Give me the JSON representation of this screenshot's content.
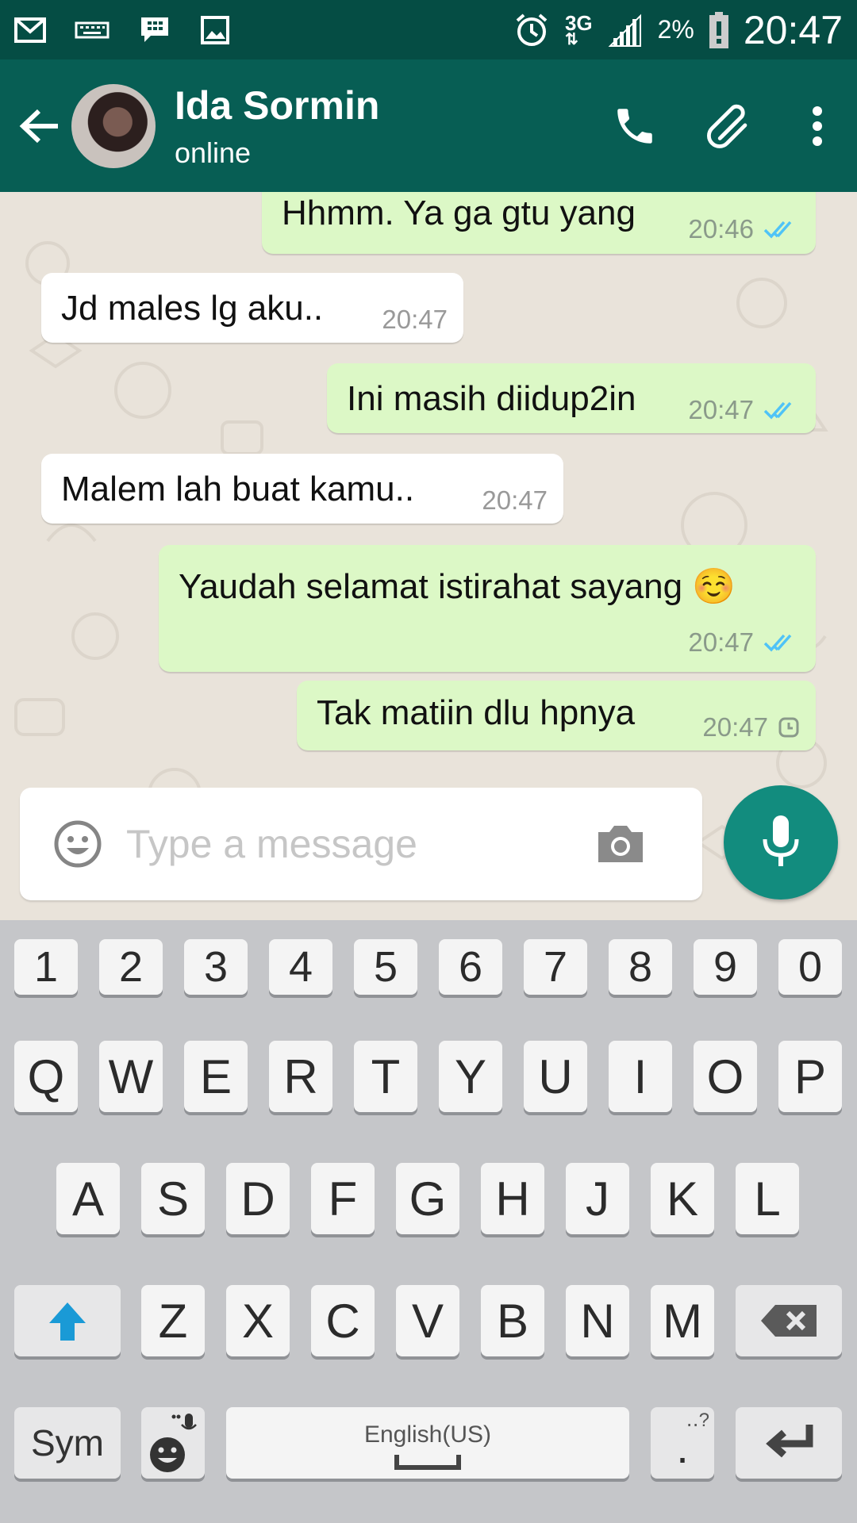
{
  "status_bar": {
    "time": "20:47",
    "battery": "2%",
    "network": "3G",
    "icons": [
      "gmail-icon",
      "keyboard-icon",
      "bbm-icon",
      "gallery-icon",
      "alarm-icon",
      "signal-icon",
      "battery-low-icon"
    ]
  },
  "header": {
    "contact_name": "Ida Sormin",
    "contact_status": "online",
    "icons": [
      "back-arrow-icon",
      "phone-icon",
      "paperclip-icon",
      "more-vert-icon"
    ]
  },
  "messages": [
    {
      "direction": "out",
      "text": "Hhmm. Ya ga gtu yang",
      "time": "20:46",
      "status": "read"
    },
    {
      "direction": "in",
      "text": "Jd males lg aku..",
      "time": "20:47"
    },
    {
      "direction": "out",
      "text": "Ini masih diidup2in",
      "time": "20:47",
      "status": "read"
    },
    {
      "direction": "in",
      "text": "Malem lah buat kamu..",
      "time": "20:47"
    },
    {
      "direction": "out",
      "text": "Yaudah selamat istirahat sayang ☺️",
      "time": "20:47",
      "status": "read"
    },
    {
      "direction": "out",
      "text": "Tak matiin dlu hpnya",
      "time": "20:47",
      "status": "pending"
    }
  ],
  "composer": {
    "placeholder": "Type a message",
    "value": ""
  },
  "keyboard": {
    "number_row": [
      "1",
      "2",
      "3",
      "4",
      "5",
      "6",
      "7",
      "8",
      "9",
      "0"
    ],
    "row1": [
      "Q",
      "W",
      "E",
      "R",
      "T",
      "Y",
      "U",
      "I",
      "O",
      "P"
    ],
    "row2": [
      "A",
      "S",
      "D",
      "F",
      "G",
      "H",
      "J",
      "K",
      "L"
    ],
    "row3": [
      "Z",
      "X",
      "C",
      "V",
      "B",
      "N",
      "M"
    ],
    "sym_label": "Sym",
    "space_label": "English(US)",
    "period": "."
  },
  "colors": {
    "status_bar": "#054d44",
    "app_bar": "#075e54",
    "outgoing_bubble": "#dcf8c6",
    "incoming_bubble": "#ffffff",
    "read_tick": "#4fc3f7",
    "fab": "#128c7e",
    "shift_active": "#1a9ad6"
  }
}
